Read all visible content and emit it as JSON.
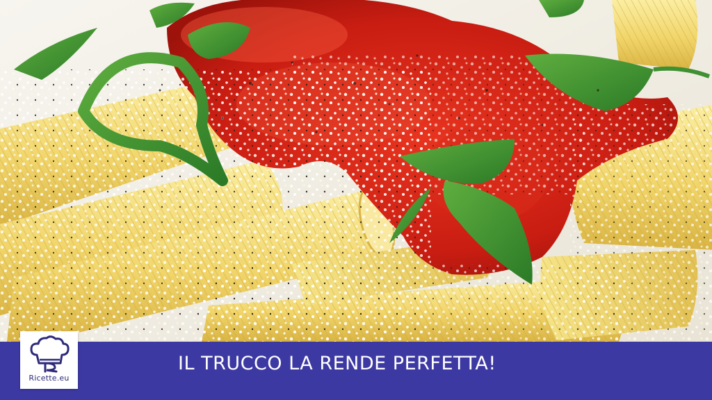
{
  "banner": {
    "headline": "IL TRUCCO LA RENDE PERFETTA!",
    "background_color": "#3d39a3"
  },
  "logo": {
    "text": "Ricette.eu",
    "icon": "chef-hat-icon"
  },
  "photo": {
    "subject": "penne-pasta-icon"
  }
}
